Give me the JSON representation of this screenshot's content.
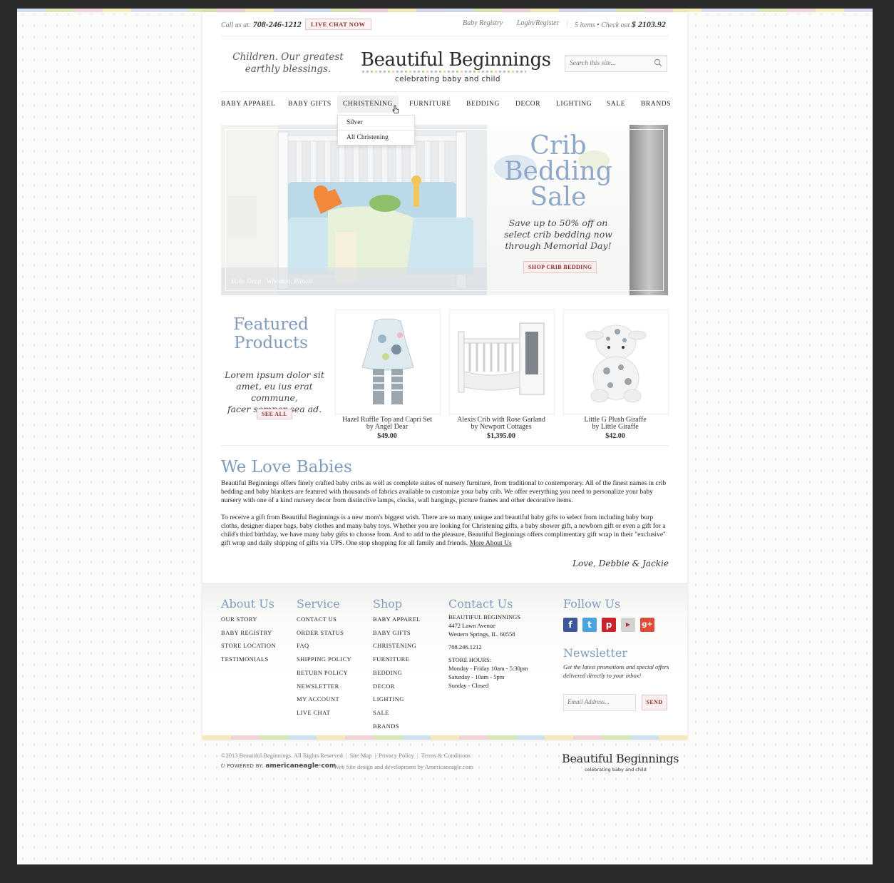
{
  "header": {
    "call_prefix": "Call us at:",
    "phone": "708-246-1212",
    "live_chat": "LIVE CHAT NOW",
    "baby_registry": "Baby Registry",
    "login": "Login/Register",
    "cart_items": "5 items",
    "checkout_label": "Check out",
    "cart_total": "$ 2103.92",
    "tagline_1": "Children. Our greatest",
    "tagline_2": "earthly blessings.",
    "logo_title": "Beautiful Beginnings",
    "logo_sub": "celebrating baby and child",
    "search_placeholder": "Search this site..."
  },
  "nav": {
    "items": [
      "BABY APPAREL",
      "BABY GIFTS",
      "CHRISTENING",
      "FURNITURE",
      "BEDDING",
      "DECOR",
      "LIGHTING",
      "SALE",
      "BRANDS"
    ],
    "active": "CHRISTENING",
    "dropdown": [
      "Silver",
      "All Christening"
    ]
  },
  "hero": {
    "title_1": "Crib",
    "title_2": "Bedding",
    "title_3": "Sale",
    "text_1": "Save up to 50% off on",
    "text_2": "select crib bedding now",
    "text_3": "through Memorial Day!",
    "button": "SHOP CRIB BEDDING",
    "credit": "Baby Dean · Wheaton, Illinois"
  },
  "featured": {
    "title_1": "Featured",
    "title_2": "Products",
    "text_1": "Lorem ipsum dolor sit",
    "text_2": "amet, eu ius erat commune,",
    "text_3": "facer semper sea ad.",
    "see_all": "SEE ALL",
    "products": [
      {
        "name": "Hazel Ruffle Top and Capri Set",
        "by": "by Angel Dear",
        "price": "$49.00"
      },
      {
        "name": "Alexis Crib with Rose Garland",
        "by": "by Newport Cottages",
        "price": "$1,395.00"
      },
      {
        "name": "Little G Plush Giraffe",
        "by": "by Little Giraffe",
        "price": "$42.00"
      }
    ]
  },
  "about": {
    "title": "We Love Babies",
    "para1": "Beautiful Beginnings offers finely crafted baby cribs as well as complete suites of nursery furniture, from traditional to contemporary. All of the finest names in crib bedding and baby blankets are featured with thousands of fabrics available to customize your baby crib. We offer everything you need to personalize your baby nursery with one of a kind nursery decor from distinctive lamps, clocks, wall hangings, picture frames and other decorative items.",
    "para2": "To receive a gift from Beautiful Beginnings is a new mom's biggest wish. There are so many unique and beautiful baby gifts to select from including baby burp cloths, designer diaper bags, baby clothes and many baby toys. Whether you are looking for Christening gifts, a baby shower gift, a newborn gift or even a gift for a child's third birthday, we have many baby gifts to choose from. And to add to the pleasure, Beautiful Beginnings offers complimentary gift wrap in their \"exclusive\" gift wrap and daily shipping of gifts via UPS. One stop shopping for all family and friends.",
    "more_link": "More About Us",
    "signature": "Love, Debbie & Jackie"
  },
  "footer": {
    "about_title": "About Us",
    "about_items": [
      "OUR STORY",
      "BABY REGISTRY",
      "STORE LOCATION",
      "TESTIMONIALS"
    ],
    "service_title": "Service",
    "service_items": [
      "CONTACT US",
      "ORDER STATUS",
      "FAQ",
      "SHIPPING POLICY",
      "RETURN POLICY",
      "NEWSLETTER",
      "MY ACCOUNT",
      "LIVE CHAT"
    ],
    "shop_title": "Shop",
    "shop_items": [
      "BABY APPAREL",
      "BABY GIFTS",
      "CHRISTENING",
      "FURNITURE",
      "BEDDING",
      "DECOR",
      "LIGHTING",
      "SALE",
      "BRANDS"
    ],
    "contact_title": "Contact Us",
    "company": "BEAUTIFUL BEGINNINGS",
    "address_1": "4472 Lawn Avenue",
    "address_2": "Western Springs, IL. 60558",
    "phone": "708.246.1212",
    "hours_title": "STORE HOURS:",
    "hours_1": "Monday - Friday 10am - 5:30pm",
    "hours_2": "Saturday - 10am - 5pm",
    "hours_3": "Sunday - Closed",
    "follow_title": "Follow Us",
    "social": [
      "facebook-icon",
      "twitter-icon",
      "pinterest-icon",
      "youtube-icon",
      "google-plus-icon"
    ],
    "newsletter_title": "Newsletter",
    "newsletter_text": "Get the latest promotions and special offers delivered directly to your inbox!",
    "email_placeholder": "Email Address...",
    "send": "SEND"
  },
  "bottom": {
    "copyright": "©2013 Beautiful Beginnings. All Rights Reserved",
    "site_map": "Site Map",
    "privacy": "Privacy Policy",
    "terms": "Terms & Conditions",
    "powered_by": "POWERED BY:",
    "powered_brand": "americaneagle·com",
    "web_design": "Web Site design and development by Americaneagle.com",
    "logo_title": "Beautiful Beginnings",
    "logo_sub": "celebrating baby and child"
  },
  "colors": {
    "accent_blue": "#7f9bbd",
    "button_red": "#8b2c2c",
    "button_bg": "#fbeeee"
  }
}
